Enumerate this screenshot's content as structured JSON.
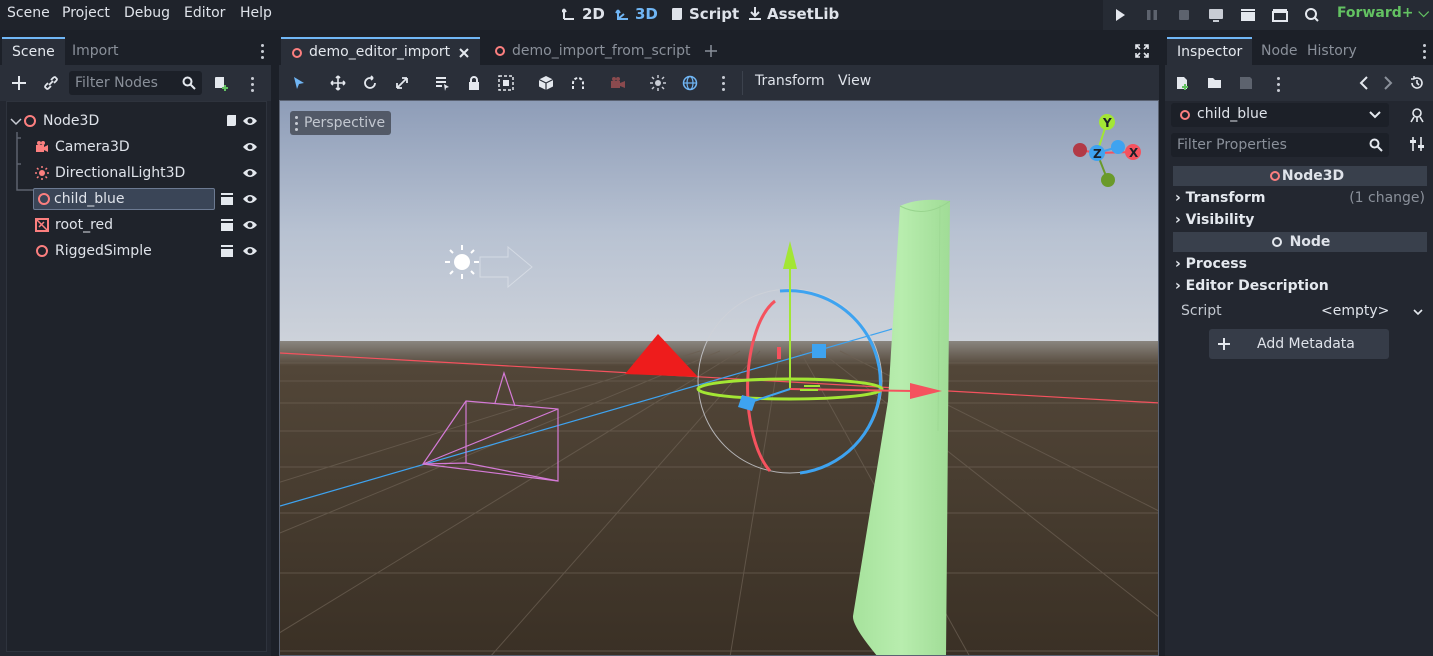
{
  "menu": {
    "items": [
      "Scene",
      "Project",
      "Debug",
      "Editor",
      "Help"
    ]
  },
  "workspaces": {
    "w2d": "2D",
    "w3d": "3D",
    "script": "Script",
    "assetlib": "AssetLib"
  },
  "renderer": "Forward+",
  "colors": {
    "accent": "#70b6f5",
    "renderer_green": "#63c262",
    "node_red": "#fc7f7f",
    "gizmo_red": "#f5525e",
    "gizmo_green": "#a3e634",
    "gizmo_blue": "#3ea3f0",
    "mesh_green": "#b0eaa6"
  },
  "scene_dock": {
    "tabs": [
      "Scene",
      "Import"
    ],
    "filter_placeholder": "Filter Nodes",
    "tree": [
      {
        "label": "Node3D",
        "icon": "node3d-icon"
      },
      {
        "label": "Camera3D",
        "icon": "camera3d-icon"
      },
      {
        "label": "DirectionalLight3D",
        "icon": "directional-light-icon"
      },
      {
        "label": "child_blue",
        "icon": "node3d-icon",
        "selected": true
      },
      {
        "label": "root_red",
        "icon": "mesh-instance-icon"
      },
      {
        "label": "RiggedSimple",
        "icon": "node3d-icon"
      }
    ]
  },
  "editor": {
    "tabs": [
      "demo_editor_import",
      "demo_import_from_script"
    ],
    "menus": {
      "transform": "Transform",
      "view": "View"
    },
    "viewport_label": "Perspective",
    "gizmo_axes": {
      "x": "X",
      "y": "Y",
      "z": "Z"
    }
  },
  "inspector": {
    "tabs": [
      "Inspector",
      "Node",
      "History"
    ],
    "selected_node": "child_blue",
    "filter_placeholder": "Filter Properties",
    "sections": {
      "node3d": "Node3D",
      "node": "Node"
    },
    "categories": {
      "transform": "Transform",
      "transform_note": "(1 change)",
      "visibility": "Visibility",
      "process": "Process",
      "editor_description": "Editor Description"
    },
    "script_label": "Script",
    "script_value": "<empty>",
    "add_metadata": "Add Metadata"
  }
}
